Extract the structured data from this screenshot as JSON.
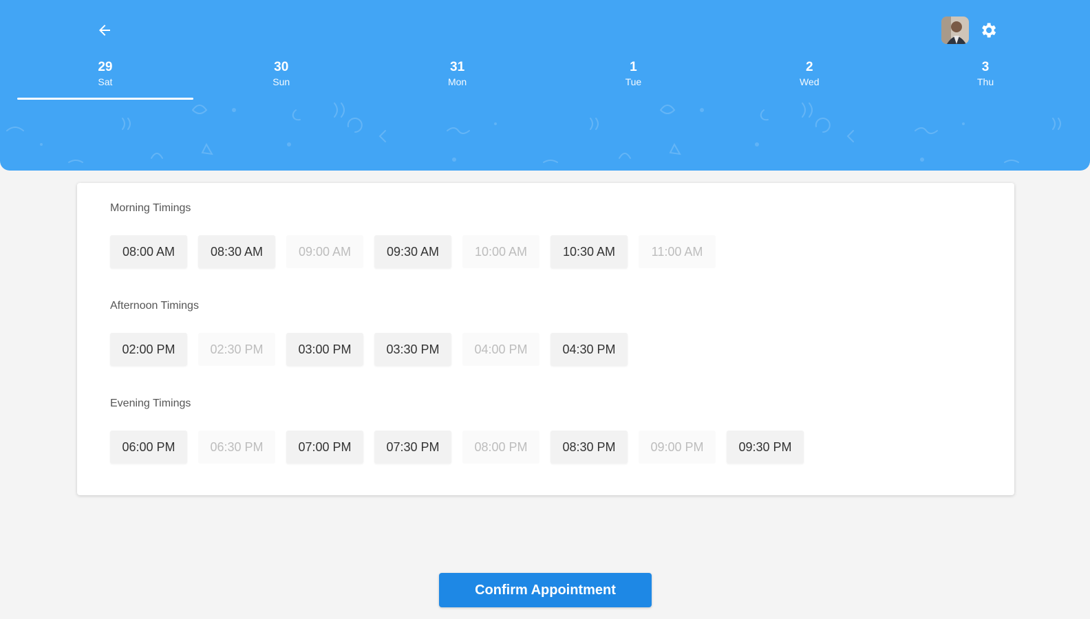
{
  "colors": {
    "header": "#42a5f5",
    "accent": "#1e88e5",
    "background": "#f4f4f4"
  },
  "header": {
    "back_icon": "arrow-left-icon",
    "settings_icon": "gear-icon"
  },
  "dates": [
    {
      "num": "29",
      "day": "Sat",
      "active": true
    },
    {
      "num": "30",
      "day": "Sun",
      "active": false
    },
    {
      "num": "31",
      "day": "Mon",
      "active": false
    },
    {
      "num": "1",
      "day": "Tue",
      "active": false
    },
    {
      "num": "2",
      "day": "Wed",
      "active": false
    },
    {
      "num": "3",
      "day": "Thu",
      "active": false
    }
  ],
  "morning": {
    "title": "Morning Timings",
    "slots": [
      {
        "time": "08:00 AM",
        "available": true
      },
      {
        "time": "08:30 AM",
        "available": true
      },
      {
        "time": "09:00 AM",
        "available": false
      },
      {
        "time": "09:30 AM",
        "available": true
      },
      {
        "time": "10:00 AM",
        "available": false
      },
      {
        "time": "10:30 AM",
        "available": true
      },
      {
        "time": "11:00 AM",
        "available": false
      }
    ]
  },
  "afternoon": {
    "title": "Afternoon Timings",
    "slots": [
      {
        "time": "02:00 PM",
        "available": true
      },
      {
        "time": "02:30 PM",
        "available": false
      },
      {
        "time": "03:00 PM",
        "available": true
      },
      {
        "time": "03:30 PM",
        "available": true
      },
      {
        "time": "04:00 PM",
        "available": false
      },
      {
        "time": "04:30 PM",
        "available": true
      }
    ]
  },
  "evening": {
    "title": "Evening Timings",
    "slots": [
      {
        "time": "06:00 PM",
        "available": true
      },
      {
        "time": "06:30 PM",
        "available": false
      },
      {
        "time": "07:00 PM",
        "available": true
      },
      {
        "time": "07:30 PM",
        "available": true
      },
      {
        "time": "08:00 PM",
        "available": false
      },
      {
        "time": "08:30 PM",
        "available": true
      },
      {
        "time": "09:00 PM",
        "available": false
      },
      {
        "time": "09:30 PM",
        "available": true
      }
    ]
  },
  "confirm_label": "Confirm Appointment"
}
